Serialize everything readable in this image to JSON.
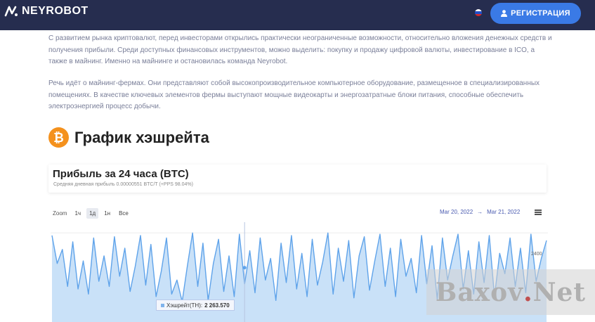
{
  "header": {
    "brand": "NEYROBOT",
    "register_label": "РЕГИСТРАЦИЯ",
    "flag_colors": [
      "#ffffff",
      "#2250c8",
      "#d62828"
    ]
  },
  "article": {
    "paragraph_1": "С развитием рынка криптовалют, перед инвесторами открылись практически неограниченные возможности, относительно вложения денежных средств и получения прибыли. Среди доступных финансовых инструментов, можно выделить: покупку и продажу цифровой валюты, инвестирование в ICO, а также в майнинг. Именно на майнинге и остановилась команда Neyrobot.",
    "paragraph_2": "Речь идёт о майнинг-фермах. Они представляют собой высокопроизводительное компьютерное оборудование, размещенное в специализированных помещениях. В качестве ключевых элементов фермы выступают мощные видеокарты и энергозатратные блоки питания, способные обеспечить электроэнергией процесс добычи."
  },
  "section": {
    "icon": "bitcoin-icon",
    "title": "График хэшрейта"
  },
  "chart_card": {
    "title": "Прибыль за 24 часа (BTC)",
    "subtitle": "Средняя дневная прибыль 0.00000551 BTC/T (+PPS 98.04%)"
  },
  "controls": {
    "zoom_label": "Zoom",
    "zoom_options": [
      "1ч",
      "1д",
      "1н",
      "Все"
    ],
    "zoom_active": "1д",
    "date_from": "Mar 20, 2022",
    "date_arrow": "→",
    "date_to": "Mar 21, 2022",
    "menu_icon": "hamburger-menu-icon"
  },
  "tooltip": {
    "series_label": "Хэшрейт(TH):",
    "value": "2 263.570"
  },
  "watermark": {
    "text_main": "Baxov",
    "text_dot": ".",
    "text_end": "Net"
  },
  "colors": {
    "topbar": "#262d4f",
    "accent": "#3a7ae6",
    "series_line": "#5fa3ea",
    "series_fill": "#bcd9f6"
  },
  "chart_data": {
    "type": "area",
    "series": [
      {
        "name": "Хэшрейт(TH)",
        "values": [
          2390,
          2280,
          2335,
          2190,
          2365,
          2180,
          2290,
          2160,
          2380,
          2210,
          2310,
          2190,
          2385,
          2230,
          2340,
          2170,
          2270,
          2390,
          2195,
          2355,
          2150,
          2250,
          2380,
          2160,
          2215,
          2130,
          2270,
          2400,
          2190,
          2360,
          2135,
          2280,
          2375,
          2170,
          2310,
          2150,
          2395,
          2200,
          2330,
          2165,
          2380,
          2215,
          2300,
          2135,
          2360,
          2205,
          2390,
          2180,
          2320,
          2150,
          2375,
          2195,
          2285,
          2400,
          2160,
          2340,
          2210,
          2370,
          2145,
          2310,
          2385,
          2175,
          2290,
          2395,
          2190,
          2340,
          2150,
          2375,
          2230,
          2300,
          2165,
          2390,
          2200,
          2350,
          2140,
          2380,
          2215,
          2310,
          2395,
          2180,
          2330,
          2160,
          2365,
          2205,
          2390,
          2150,
          2320,
          2240,
          2380,
          2190,
          2340,
          2165,
          2395,
          2210,
          2300,
          2370
        ]
      }
    ],
    "y_ticks": [
      2400
    ],
    "tooltip_value": 2263.57
  }
}
